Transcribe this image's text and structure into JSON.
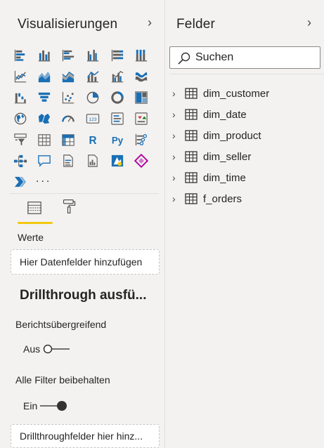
{
  "visualizations": {
    "title": "Visualisierungen",
    "more_label": "...",
    "tabs": {
      "active": "fields-build"
    },
    "values_label": "Werte",
    "add_fields_placeholder": "Hier Datenfelder hinzufügen",
    "drillthrough": {
      "title": "Drillthrough ausfü...",
      "cross_report_label": "Berichtsübergreifend",
      "cross_report_state": "Aus",
      "keep_filters_label": "Alle Filter beibehalten",
      "keep_filters_state": "Ein",
      "drop_placeholder": "Drillthroughfelder hier hinz..."
    }
  },
  "fields": {
    "title": "Felder",
    "search_placeholder": "Suchen",
    "tables": [
      "dim_customer",
      "dim_date",
      "dim_product",
      "dim_seller",
      "dim_time",
      "f_orders"
    ]
  },
  "colors": {
    "accent_yellow": "#f2c811",
    "icon_blue": "#1a6fb5",
    "icon_gray": "#605e5c",
    "panel_bg": "#f3f2f1"
  }
}
